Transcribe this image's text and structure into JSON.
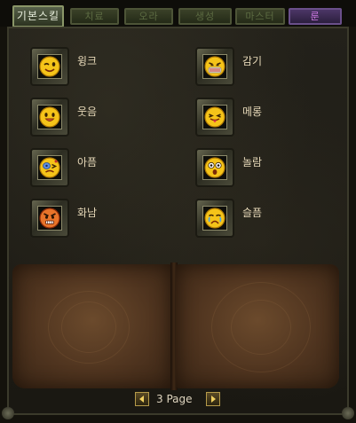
{
  "tabs": [
    {
      "label": "기본스킬",
      "active": true
    },
    {
      "label": "치료",
      "active": false
    },
    {
      "label": "오라",
      "active": false
    },
    {
      "label": "생성",
      "active": false
    },
    {
      "label": "마스터",
      "active": false
    },
    {
      "label": "룬",
      "active": false,
      "color": "#d27ae6"
    }
  ],
  "skills": [
    {
      "label": "윙크",
      "icon": "wink-emoticon-icon"
    },
    {
      "label": "감기",
      "icon": "cold-masked-emoticon-icon"
    },
    {
      "label": "웃음",
      "icon": "laugh-emoticon-icon"
    },
    {
      "label": "메롱",
      "icon": "tongue-out-emoticon-icon"
    },
    {
      "label": "아픔",
      "icon": "hurt-emoticon-icon"
    },
    {
      "label": "놀람",
      "icon": "surprised-emoticon-icon"
    },
    {
      "label": "화남",
      "icon": "angry-emoticon-icon"
    },
    {
      "label": "슬픔",
      "icon": "sad-emoticon-icon"
    }
  ],
  "pager": {
    "text": "3 Page"
  },
  "colors": {
    "accent": "#b59a4a",
    "label": "#e6d8b8",
    "rune_tab": "#d27ae6"
  }
}
